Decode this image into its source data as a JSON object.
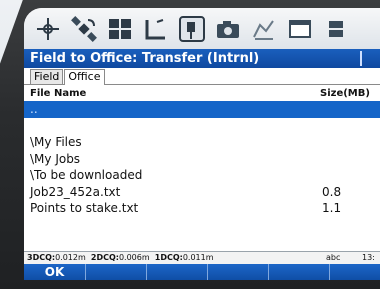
{
  "toolbar": {
    "icons": [
      "crosshair-icon",
      "satellite-icon",
      "keypad-icon",
      "level-icon",
      "survey-instrument-icon",
      "camera-icon",
      "map-edit-icon",
      "window-icon",
      "extra-icon"
    ]
  },
  "title": "Field to Office: Transfer (Intrnl)",
  "tabs": [
    {
      "label": "Field",
      "active": false
    },
    {
      "label": "Office",
      "active": true
    }
  ],
  "list": {
    "headers": {
      "name": "File Name",
      "size": "Size(MB)"
    },
    "rows": [
      {
        "name": "..",
        "size": "",
        "selected": true
      },
      {
        "name": "",
        "size": "",
        "selected": false
      },
      {
        "name": "\\My Files",
        "size": "",
        "selected": false
      },
      {
        "name": "\\My Jobs",
        "size": "",
        "selected": false
      },
      {
        "name": "\\To be downloaded",
        "size": "",
        "selected": false
      },
      {
        "name": "Job23_452a.txt",
        "size": "0.8",
        "selected": false
      },
      {
        "name": "Points to stake.txt",
        "size": "1.1",
        "selected": false
      }
    ]
  },
  "status": {
    "dcq3_label": "3DCQ:",
    "dcq3_value": "0.012m",
    "dcq2_label": "2DCQ:",
    "dcq2_value": "0.006m",
    "dcq1_label": "1DCQ:",
    "dcq1_value": "0.011m",
    "input_mode": "abc",
    "time": "13:"
  },
  "softkeys": [
    "OK",
    "",
    "",
    "",
    "",
    ""
  ],
  "colors": {
    "title_bg": "#1a5fbd",
    "selection": "#1565c8",
    "softkey_bg": "#1d66c7"
  }
}
